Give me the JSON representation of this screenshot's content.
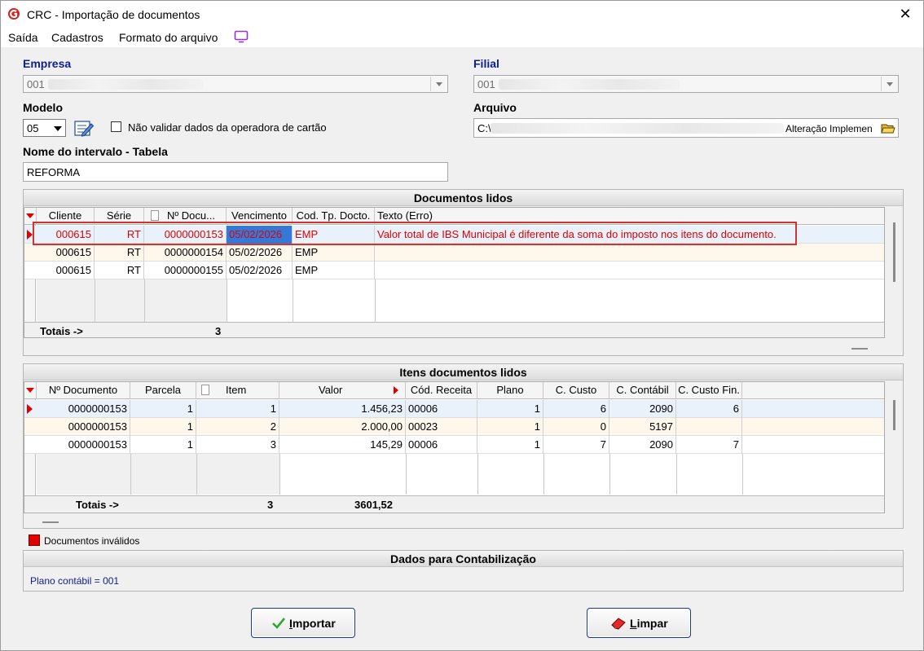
{
  "window": {
    "title": "CRC - Importação de documentos",
    "close_glyph": "✕"
  },
  "menu": {
    "items": [
      "Saída",
      "Cadastros",
      "Formato do arquivo"
    ]
  },
  "form": {
    "empresa_label": "Empresa",
    "empresa_value": "001",
    "filial_label": "Filial",
    "filial_value": "001",
    "modelo_label": "Modelo",
    "modelo_value": "05",
    "nao_validar_label": "Não validar dados da operadora de cartão",
    "nao_validar_checked": false,
    "arquivo_label": "Arquivo",
    "arquivo_value_prefix": "C:\\",
    "arquivo_value_tail": "Alteração Implemen",
    "intervalo_label": "Nome do intervalo - Tabela",
    "intervalo_value": "REFORMA"
  },
  "documentos": {
    "title": "Documentos lidos",
    "headers": [
      "Cliente",
      "Série",
      "Nº Docu...",
      "Vencimento",
      "Cod. Tp. Docto.",
      "Texto (Erro)"
    ],
    "rows": [
      {
        "cliente": "000615",
        "serie": "RT",
        "numero": "0000000153",
        "vencimento": "05/02/2026",
        "tipo": "EMP",
        "texto": "Valor total de IBS Municipal é diferente da soma do imposto nos itens do documento.",
        "invalid": true
      },
      {
        "cliente": "000615",
        "serie": "RT",
        "numero": "0000000154",
        "vencimento": "05/02/2026",
        "tipo": "EMP",
        "texto": "",
        "invalid": false
      },
      {
        "cliente": "000615",
        "serie": "RT",
        "numero": "0000000155",
        "vencimento": "05/02/2026",
        "tipo": "EMP",
        "texto": "",
        "invalid": false
      }
    ],
    "totals_label": "Totais ->",
    "totals_count": "3"
  },
  "itens": {
    "title": "Itens documentos lidos",
    "headers": [
      "Nº Documento",
      "Parcela",
      "Item",
      "Valor",
      "Cód. Receita",
      "Plano",
      "C. Custo",
      "C. Contábil",
      "C. Custo Fin."
    ],
    "rows": [
      {
        "documento": "0000000153",
        "parcela": "1",
        "item": "1",
        "valor": "1.456,23",
        "receita": "00006",
        "plano": "1",
        "custo": "6",
        "contabil": "2090",
        "custo_fin": "6"
      },
      {
        "documento": "0000000153",
        "parcela": "1",
        "item": "2",
        "valor": "2.000,00",
        "receita": "00023",
        "plano": "1",
        "custo": "0",
        "contabil": "5197",
        "custo_fin": ""
      },
      {
        "documento": "0000000153",
        "parcela": "1",
        "item": "3",
        "valor": "145,29",
        "receita": "00006",
        "plano": "1",
        "custo": "7",
        "contabil": "2090",
        "custo_fin": "7"
      }
    ],
    "totals_label": "Totais ->",
    "totals_count": "3",
    "totals_valor": "3601,52"
  },
  "legend": {
    "label": "Documentos inválidos",
    "color": "#e00000"
  },
  "contabilizacao": {
    "title": "Dados para Contabilização",
    "plano_text": "Plano contábil = 001"
  },
  "buttons": {
    "importar_first": "I",
    "importar_rest": "mportar",
    "limpar_first": "L",
    "limpar_rest": "impar"
  },
  "colors": {
    "invalid_text": "#e00000",
    "label_blue": "#10208a",
    "selection": "#3478d8"
  }
}
